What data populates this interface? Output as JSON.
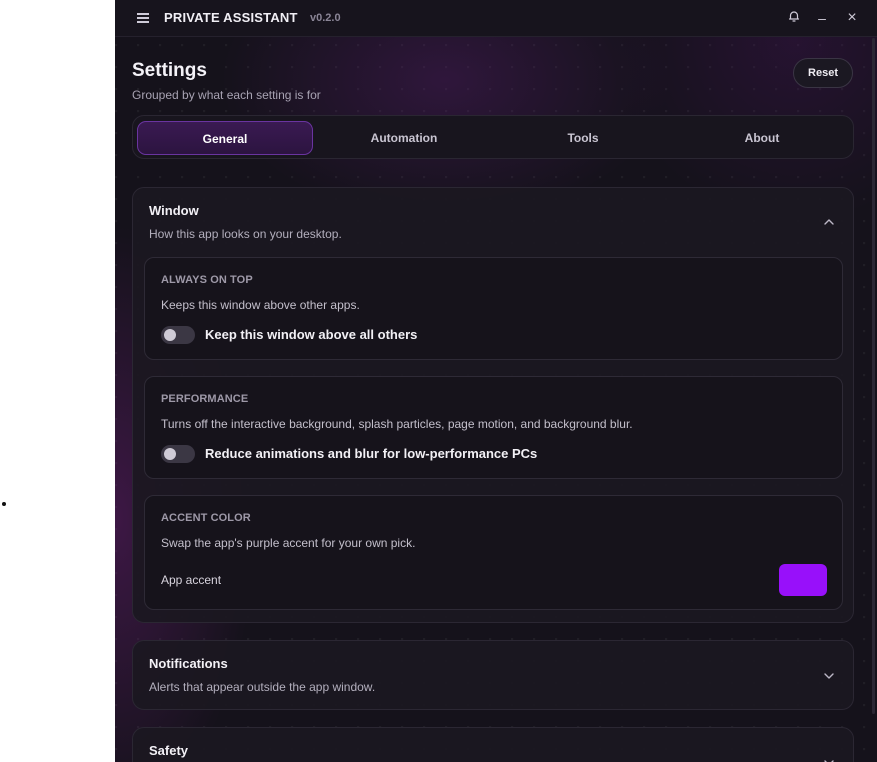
{
  "app": {
    "title": "PRIVATE ASSISTANT",
    "version": "v0.2.0"
  },
  "titlebar": {
    "minimize_glyph": "–",
    "close_glyph": "×"
  },
  "page": {
    "title": "Settings",
    "subtitle": "Grouped by what each setting is for",
    "reset_label": "Reset"
  },
  "tabs": [
    {
      "label": "General",
      "active": true
    },
    {
      "label": "Automation",
      "active": false
    },
    {
      "label": "Tools",
      "active": false
    },
    {
      "label": "About",
      "active": false
    }
  ],
  "sections": {
    "window": {
      "title": "Window",
      "subtitle": "How this app looks on your desktop.",
      "expanded": true,
      "cards": {
        "always_on_top": {
          "label": "ALWAYS ON TOP",
          "description": "Keeps this window above other apps.",
          "toggle_label": "Keep this window above all others",
          "enabled": false
        },
        "performance": {
          "label": "PERFORMANCE",
          "description": "Turns off the interactive background, splash particles, page motion, and background blur.",
          "toggle_label": "Reduce animations and blur for low-performance PCs",
          "enabled": false
        },
        "accent_color": {
          "label": "ACCENT COLOR",
          "description": "Swap the app's purple accent for your own pick.",
          "field_label": "App accent",
          "value": "#9810fa"
        }
      }
    },
    "notifications": {
      "title": "Notifications",
      "subtitle": "Alerts that appear outside the app window.",
      "expanded": false
    },
    "safety": {
      "title": "Safety",
      "expanded": false
    }
  },
  "icons": {
    "menu": "menu-icon",
    "bell": "bell-icon",
    "minimize": "minimize-icon",
    "close": "close-icon",
    "collapse": "chevron-up-icon",
    "expand": "chevron-down-icon"
  },
  "colors": {
    "accent": "#9810fa",
    "background": "#15121b"
  }
}
